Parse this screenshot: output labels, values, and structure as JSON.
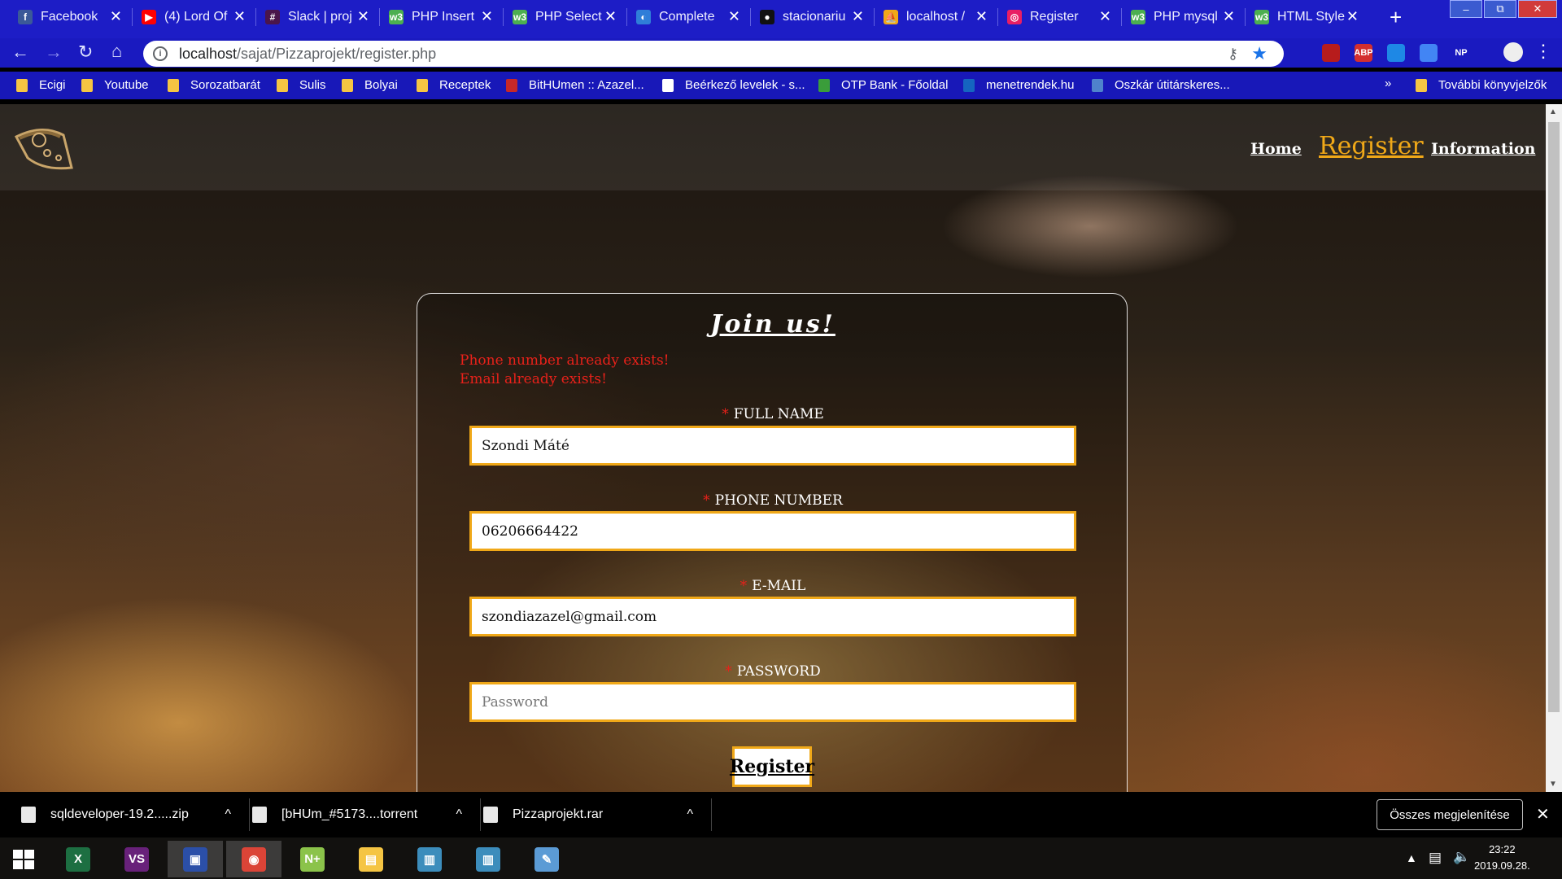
{
  "browser": {
    "tabs": [
      {
        "title": "Facebook",
        "icon": "facebook-icon",
        "color": "#3b5998",
        "glyph": "f"
      },
      {
        "title": "(4) Lord Of",
        "icon": "youtube-icon",
        "color": "#ff0000",
        "glyph": "▶"
      },
      {
        "title": "Slack | proj",
        "icon": "slack-icon",
        "color": "#4a154b",
        "glyph": "#"
      },
      {
        "title": "PHP Insert",
        "icon": "w3schools-icon",
        "color": "#4caf50",
        "glyph": "w3"
      },
      {
        "title": "PHP Select",
        "icon": "w3schools-icon",
        "color": "#4caf50",
        "glyph": "w3"
      },
      {
        "title": "Complete",
        "icon": "globe-icon",
        "color": "#2f7ed8",
        "glyph": "◐"
      },
      {
        "title": "stacionariu",
        "icon": "github-icon",
        "color": "#111111",
        "glyph": "●"
      },
      {
        "title": "localhost /",
        "icon": "phpmyadmin-icon",
        "color": "#f0a818",
        "glyph": "⛵"
      },
      {
        "title": "Register",
        "icon": "page-icon",
        "color": "#e91e63",
        "glyph": "◎"
      },
      {
        "title": "PHP mysql",
        "icon": "w3schools-icon",
        "color": "#4caf50",
        "glyph": "w3"
      },
      {
        "title": "HTML Style",
        "icon": "w3schools-icon",
        "color": "#4caf50",
        "glyph": "w3"
      }
    ],
    "new_tab": "+",
    "url_host": "localhost",
    "url_path": "/sajat/Pizzaprojekt/register.php",
    "extensions": [
      {
        "label": "",
        "icon": "pdf-icon",
        "color": "#b71c1c"
      },
      {
        "label": "ABP",
        "icon": "adblock-icon",
        "color": "#d32f2f"
      },
      {
        "label": "",
        "icon": "bookmark-ext-icon",
        "color": "#1e88e5"
      },
      {
        "label": "",
        "icon": "translate-icon",
        "color": "#4285f4"
      },
      {
        "label": "NP",
        "icon": "np-icon",
        "color": "#1a1ac0"
      }
    ],
    "bookmarks": [
      {
        "label": "Ecigi",
        "icon": "folder-icon"
      },
      {
        "label": "Youtube",
        "icon": "folder-icon"
      },
      {
        "label": "Sorozatbarát",
        "icon": "folder-icon"
      },
      {
        "label": "Sulis",
        "icon": "folder-icon"
      },
      {
        "label": "Bolyai",
        "icon": "folder-icon"
      },
      {
        "label": "Receptek",
        "icon": "folder-icon"
      },
      {
        "label": "BitHUmen :: Azazel...",
        "icon": "bithumen-icon"
      },
      {
        "label": "Beérkező levelek - s...",
        "icon": "gmail-icon"
      },
      {
        "label": "OTP Bank - Főoldal",
        "icon": "otp-icon"
      },
      {
        "label": "menetrendek.hu",
        "icon": "menetrendek-icon"
      },
      {
        "label": "Oszkár útitárskeres...",
        "icon": "car-icon"
      }
    ],
    "bookmarks_more": "»",
    "other_bookmarks": "További könyvjelzők"
  },
  "site": {
    "nav": {
      "home": "Home",
      "register": "Register",
      "information": "Information"
    },
    "form": {
      "title": "Join us!",
      "errors": [
        "Phone number already exists!",
        "Email already exists!"
      ],
      "required_mark": "*",
      "fields": [
        {
          "label": "FULL NAME",
          "value": "Szondi Máté",
          "placeholder": ""
        },
        {
          "label": "PHONE NUMBER",
          "value": "06206664422",
          "placeholder": ""
        },
        {
          "label": "E-MAIL",
          "value": "szondiazazel@gmail.com",
          "placeholder": ""
        },
        {
          "label": "PASSWORD",
          "value": "",
          "placeholder": "Password"
        }
      ],
      "submit": "Register"
    },
    "accent_color": "#f0a818",
    "error_color": "#e8211a"
  },
  "downloads": {
    "items": [
      {
        "name": "sqldeveloper-19.2.....zip",
        "icon": "zip-icon"
      },
      {
        "name": "[bHUm_#5173....torrent",
        "icon": "torrent-icon"
      },
      {
        "name": "Pizzaprojekt.rar",
        "icon": "rar-icon"
      }
    ],
    "show_all": "Összes megjelenítése"
  },
  "taskbar": {
    "apps": [
      {
        "icon": "excel-icon",
        "glyph": "X",
        "color": "#1d6f42"
      },
      {
        "icon": "visual-studio-icon",
        "glyph": "VS",
        "color": "#68217a"
      },
      {
        "icon": "save-disk-icon",
        "glyph": "▣",
        "color": "#2b4fa8"
      },
      {
        "icon": "chrome-icon",
        "glyph": "◉",
        "color": "#db4437"
      },
      {
        "icon": "notepad-plus-icon",
        "glyph": "N+",
        "color": "#8bc34a"
      },
      {
        "icon": "file-explorer-icon",
        "glyph": "▤",
        "color": "#f5c543"
      },
      {
        "icon": "window-app-icon",
        "glyph": "▥",
        "color": "#3c8dbc"
      },
      {
        "icon": "window-app-icon",
        "glyph": "▥",
        "color": "#3c8dbc"
      },
      {
        "icon": "paint-icon",
        "glyph": "✎",
        "color": "#5b9bd5"
      }
    ],
    "time": "23:22",
    "date": "2019.09.28."
  }
}
